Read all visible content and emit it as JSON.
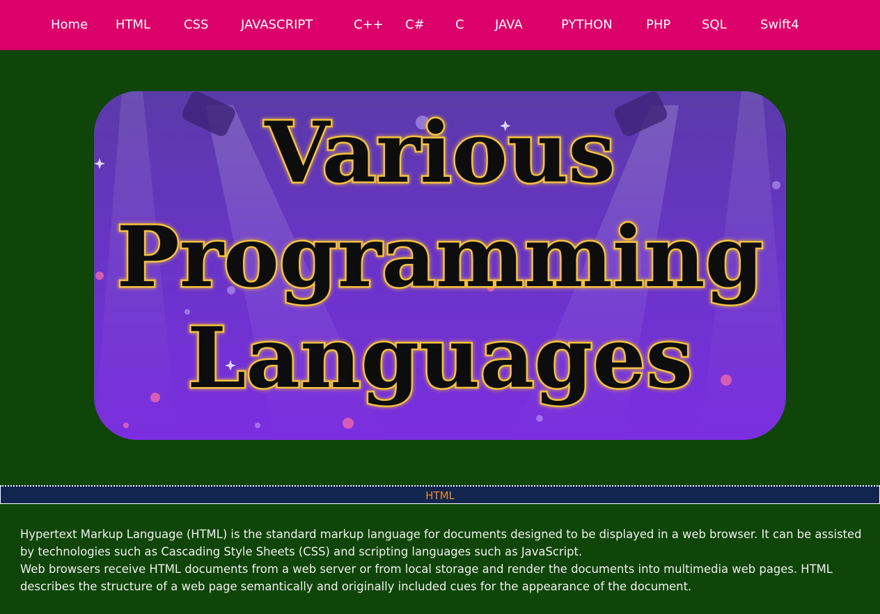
{
  "nav": {
    "items": [
      {
        "label": "Home"
      },
      {
        "label": "HTML"
      },
      {
        "label": "CSS"
      },
      {
        "label": "JAVASCRIPT"
      },
      {
        "label": "C++"
      },
      {
        "label": "C#"
      },
      {
        "label": "C"
      },
      {
        "label": "JAVA"
      },
      {
        "label": "PYTHON"
      },
      {
        "label": "PHP"
      },
      {
        "label": "SQL"
      },
      {
        "label": "Swift4"
      }
    ]
  },
  "hero": {
    "lines": [
      "Various",
      "Programming",
      "Languages"
    ]
  },
  "section": {
    "title": "HTML",
    "paragraphs": [
      "Hypertext Markup Language (HTML) is the standard markup language for documents designed to be displayed in a web browser. It can be assisted by technologies such as Cascading Style Sheets (CSS) and scripting languages such as JavaScript.",
      "Web browsers receive HTML documents from a web server or from local storage and render the documents into multimedia web pages. HTML describes the structure of a web page semantically and originally included cues for the appearance of the document."
    ]
  },
  "colors": {
    "navbar": "#dc006a",
    "page_background": "#0f4508",
    "section_bar": "#12254e",
    "section_title": "#f08c2e",
    "hero_purple": "#6a33c8",
    "hero_text_glow": "#f5c242"
  }
}
